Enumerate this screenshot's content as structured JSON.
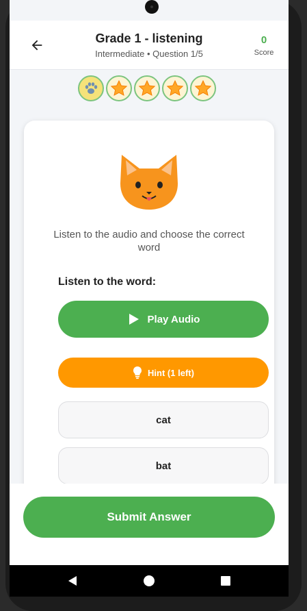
{
  "header": {
    "title": "Grade 1 - listening",
    "subtitle": "Intermediate • Question 1/5",
    "score_value": "0",
    "score_label": "Score"
  },
  "progress": {
    "total": 5,
    "current": 1,
    "icons": [
      "paw-icon",
      "star-icon",
      "star-icon",
      "star-icon",
      "star-icon"
    ]
  },
  "question": {
    "emoji_icon": "cat-face-icon",
    "instruction": "Listen to the audio and choose the correct word",
    "prompt_label": "Listen to the word:"
  },
  "buttons": {
    "play_audio": "Play Audio",
    "hint": "Hint (1 left)",
    "submit": "Submit Answer"
  },
  "options": [
    "cat",
    "bat"
  ],
  "colors": {
    "primary_green": "#4caf50",
    "hint_orange": "#ff9800",
    "score_green": "#4caf50"
  }
}
